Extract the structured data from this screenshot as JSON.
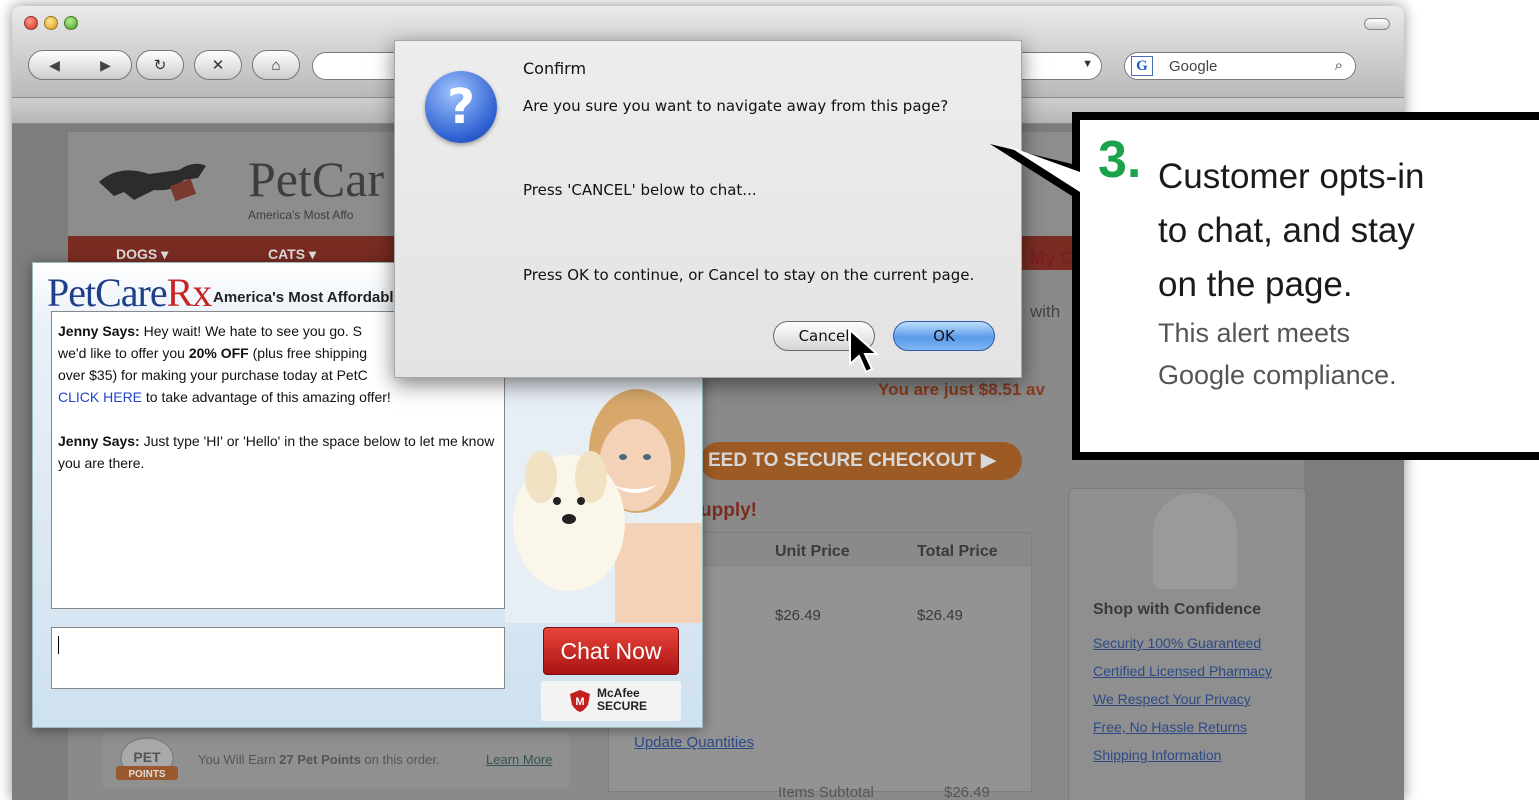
{
  "browser": {
    "search_placeholder": "Google",
    "google_logo": "G",
    "icons": [
      "back-arrow-icon",
      "forward-arrow-icon",
      "reload-icon",
      "stop-icon",
      "home-icon",
      "search-icon",
      "dropdown-icon"
    ]
  },
  "site": {
    "logo": "PetCar",
    "tagline": "America's Most Affo",
    "nav": [
      "DOGS ▾",
      "CATS ▾"
    ],
    "my_cart": "My C",
    "with_text": "with",
    "just_away": "You are just $8.51 av",
    "checkout": "EED TO SECURE CHECKOUT ▶",
    "supply": "upply!",
    "table_headers": [
      "Unit Price",
      "Total Price"
    ],
    "row_values": [
      "$26.49",
      "$26.49"
    ],
    "update_quantities": "Update Quantities",
    "items_subtotal": "Items Subtotal",
    "items_subtotal_value": "$26.49",
    "shop_title": "Shop with Confidence",
    "shop_links": [
      "Security 100% Guaranteed",
      "Certified Licensed Pharmacy",
      "We Respect Your Privacy",
      "Free, No Hassle Returns",
      "Shipping Information"
    ],
    "points_badge_top": "PET",
    "points_badge_bottom": "POINTS",
    "points_text_before": "You Will Earn ",
    "points_text_bold": "27 Pet Points",
    "points_text_after": " on this order.",
    "learn_more": "Learn More"
  },
  "chat": {
    "logo_main": "PetCare",
    "logo_rx": "Rx",
    "tagline": "America's Most Affordabl",
    "msg1_speaker": "Jenny Says:",
    "msg1_a": " Hey wait! We hate to see you go. S",
    "msg1_b": "we'd like to offer you ",
    "msg1_bold": "20% OFF",
    "msg1_c": " (plus free shipping",
    "msg1_d": "over $35) for making your purchase today at PetC",
    "msg1_link": "CLICK HERE",
    "msg1_e": " to take advantage of this amazing offer!",
    "msg2_speaker": "Jenny Says:",
    "msg2_text": " Just type 'HI' or 'Hello' in the space below to let me know you are there.",
    "chat_now": "Chat Now",
    "mcafee_line1": "McAfee",
    "mcafee_line2": "SECURE"
  },
  "dialog": {
    "title": "Confirm",
    "line1": "Are you sure you want to navigate away from this page?",
    "line2": "Press 'CANCEL' below to chat...",
    "line3": "Press OK to continue, or Cancel to stay on the current page.",
    "cancel": "Cancel",
    "ok": "OK",
    "icon": "?"
  },
  "callout": {
    "number": "3.",
    "line1": "Customer opts-in",
    "line2": "to chat, and stay",
    "line3": "on the page.",
    "sub1": "This alert meets",
    "sub2": "Google compliance."
  }
}
